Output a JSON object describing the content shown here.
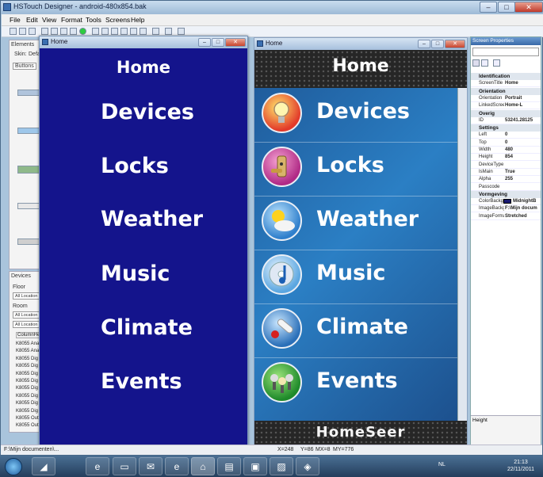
{
  "window": {
    "title": "HSTouch Designer - android-480x854.bak"
  },
  "menu": [
    "File",
    "Edit",
    "View",
    "Format",
    "Tools",
    "Screens",
    "Help"
  ],
  "left_panels": {
    "elements_label": "Elements",
    "skin_label": "Skin:",
    "skin_value": "Defa",
    "buttons_tab": "Buttons",
    "devices_label": "Devices",
    "floor_label": "Floor",
    "floor_value": "All Location",
    "room_label": "Room",
    "room_value": "All Location",
    "room_value2": "All Location",
    "column_header": "ColumnHe",
    "device_rows": [
      "K8055 Ana",
      "K8055 Ana",
      "K8055 Dig",
      "K8055 Dig",
      "K8055 Dig",
      "K8055 Dig",
      "K8055 Dig",
      "K8055 Dig",
      "K8055 Dig",
      "K8055 Dig",
      "K8055 Out",
      "K8055 Out"
    ]
  },
  "preview_left": {
    "title": "Home",
    "heading": "Home",
    "items": [
      "Devices",
      "Locks",
      "Weather",
      "Music",
      "Climate",
      "Events"
    ],
    "bg_color": "#14148c"
  },
  "preview_right": {
    "title": "Home",
    "heading": "Home",
    "items": [
      {
        "label": "Devices",
        "icon": "lightbulb-icon"
      },
      {
        "label": "Locks",
        "icon": "door-lock-icon"
      },
      {
        "label": "Weather",
        "icon": "weather-sun-cloud-icon"
      },
      {
        "label": "Music",
        "icon": "music-cd-icon"
      },
      {
        "label": "Climate",
        "icon": "thermometer-icon"
      },
      {
        "label": "Events",
        "icon": "bulbs-icon"
      }
    ],
    "brand": "HomeSeer"
  },
  "properties": {
    "title": "Screen Properties",
    "sections": [
      {
        "name": "Identification",
        "rows": [
          [
            "ScreenTitle",
            "Home"
          ]
        ]
      },
      {
        "name": "Orientation",
        "rows": [
          [
            "Orientation",
            "Portrait"
          ],
          [
            "LinkedScree",
            "Home-L"
          ]
        ]
      },
      {
        "name": "Overig",
        "rows": [
          [
            "ID",
            "53241.28125"
          ]
        ]
      },
      {
        "name": "Settings",
        "rows": [
          [
            "Left",
            "0"
          ],
          [
            "Top",
            "0"
          ],
          [
            "Width",
            "480"
          ],
          [
            "Height",
            "854"
          ],
          [
            "DeviceType",
            ""
          ],
          [
            "IsMain",
            "True"
          ],
          [
            "Alpha",
            "255"
          ],
          [
            "Passcode",
            ""
          ]
        ]
      },
      {
        "name": "Vormgeving",
        "rows": [
          [
            "ColorBackg",
            "MidnightB"
          ],
          [
            "ImageBackg",
            "F:\\Mijn docum"
          ],
          [
            "ImageForma",
            "Stretched"
          ]
        ]
      }
    ],
    "description_title": "Height"
  },
  "status": {
    "path": "F:\\Mijn documenten\\...",
    "x": "X=248",
    "y": "Y=86",
    "mx": "MX=8",
    "my": "MY=776"
  },
  "taskbar": {
    "lang": "NL",
    "time": "21:13",
    "date": "22/11/2011"
  }
}
